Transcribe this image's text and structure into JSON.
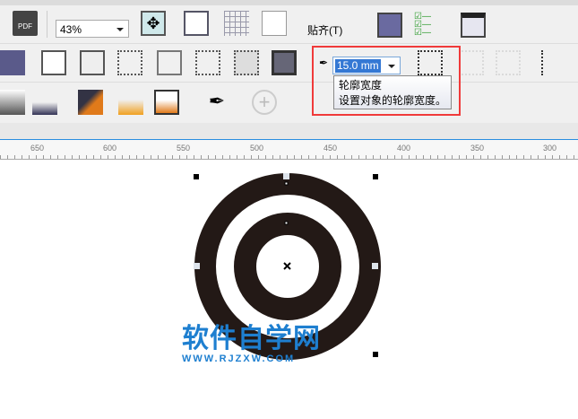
{
  "toolbar": {
    "zoom_value": "43%",
    "snap_label": "贴齐(T)"
  },
  "property_bar": {
    "outline_width_value": "15.0 mm"
  },
  "tooltip": {
    "title": "轮廓宽度",
    "description": "设置对象的轮廓宽度。"
  },
  "ruler": {
    "ticks": [
      "650",
      "600",
      "550",
      "500",
      "450",
      "400",
      "350",
      "300"
    ]
  },
  "watermark": {
    "title": "软件自学网",
    "url": "WWW.RJZXW.COM"
  },
  "colors": {
    "accent": "#2a8de0",
    "highlight": "#f03a3a",
    "shape": "#231916",
    "watermark": "#1e7fd0"
  }
}
